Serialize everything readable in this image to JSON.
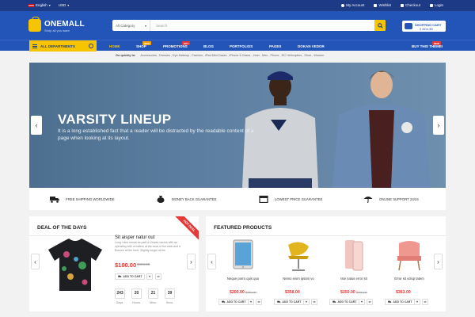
{
  "topbar": {
    "language": "English",
    "currency": "USD",
    "my_account": "My Account",
    "wishlist": "Wishlist",
    "checkout": "Checkout",
    "login": "Login"
  },
  "header": {
    "logo": "ONEMALL",
    "tagline": "Shop all you want",
    "search_category": "All Category",
    "search_placeholder": "Search",
    "cart_title": "SHOPPING CART",
    "cart_value": "0 Item-$0"
  },
  "nav": {
    "all_departments": "ALL DEPARTMENTS",
    "items": [
      {
        "label": "HOME"
      },
      {
        "label": "SHOP",
        "badge": "NEW"
      },
      {
        "label": "PROMOTIONS",
        "badge": "HOT"
      },
      {
        "label": "BLOG"
      },
      {
        "label": "PORTFOLIOS"
      },
      {
        "label": "PAGES"
      },
      {
        "label": "DOKAN VEDOR"
      }
    ],
    "right_item": {
      "label": "BUY THIS THEME!",
      "badge": "NEW"
    }
  },
  "quick_links": {
    "label": "Go quickly to:",
    "items": "Accessories , Dresses , Eye Makeup , Fashion , iPad Mini Cases , iPhone 6 Cases , Jean , Men , Phone , RC Helicopters , Shoe , Women"
  },
  "banner": {
    "title": "VARSITY LINEUP",
    "body": "It is a long established fact that a reader will be distracted by the readable content of a page when looking at its layout."
  },
  "features": [
    {
      "label": "FREE SHIPPING WORLDWIDE",
      "icon": "truck-icon"
    },
    {
      "label": "MONEY BACK GUARANTEE",
      "icon": "money-bag-icon"
    },
    {
      "label": "LOWEST PRICE GUARANTEE",
      "icon": "calendar-icon"
    },
    {
      "label": "ONLINE SUPPORT 24/24",
      "icon": "umbrella-icon"
    }
  ],
  "deal": {
    "title": "DEAL OF THE DAYS",
    "ribbon": "HOT DEAL",
    "product_name": "Sit aisper natur out",
    "description": "Long i diea nenda sa parit a Uroces ramies with an operating with ut bullton at the beck of the neck and a Bounce all the form. Slightly longer at the",
    "price": "$100.00",
    "old_price": "$300.00",
    "add_to_cart": "ADD TO CART",
    "countdown": [
      {
        "value": "243",
        "unit": "Days"
      },
      {
        "value": "20",
        "unit": "Hours"
      },
      {
        "value": "21",
        "unit": "Mins"
      },
      {
        "value": "39",
        "unit": "Secs"
      }
    ]
  },
  "featured": {
    "title": "FEATURED PRODUCTS",
    "products": [
      {
        "name": "Neque porro quis quo",
        "price": "$200.00",
        "old_price": "$250.00",
        "add": "ADD TO CART"
      },
      {
        "name": "Nemo enim ipsam vo",
        "price": "$358.00",
        "old_price": "",
        "add": "ADD TO CART"
      },
      {
        "name": "Iste natus error sit",
        "price": "$150.00",
        "old_price": "$200.00",
        "add": "ADD TO CART"
      },
      {
        "name": "Error sit volup tatem",
        "price": "$363.00",
        "old_price": "",
        "add": "ADD TO CART"
      }
    ]
  },
  "colors": {
    "brand_blue": "#2354b8",
    "dark_blue": "#1c3a86",
    "accent_yellow": "#f7c400",
    "sale_red": "#e53935"
  }
}
